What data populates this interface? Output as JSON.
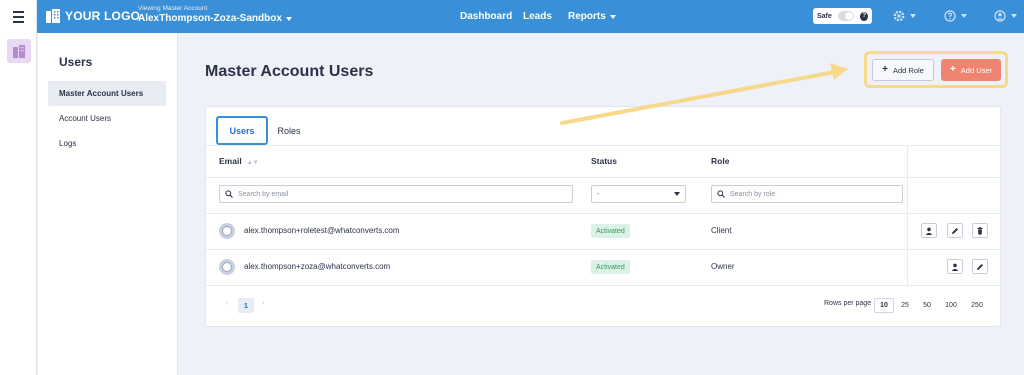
{
  "header": {
    "logo_text": "YOUR LOGO",
    "account_sub": "Viewing Master Account",
    "account_name": "AlexThompson-Zoza-Sandbox",
    "nav": [
      {
        "label": "Dashboard"
      },
      {
        "label": "Leads"
      },
      {
        "label": "Reports"
      }
    ],
    "safe_label": "Safe",
    "safe_help": "?",
    "colors": {
      "bar": "#3a8fd9",
      "accent": "#ef8470"
    }
  },
  "sidebar": {
    "title": "Users",
    "items": [
      {
        "label": "Master Account Users",
        "active": true
      },
      {
        "label": "Account Users",
        "active": false
      },
      {
        "label": "Logs",
        "active": false
      }
    ]
  },
  "main": {
    "title": "Master Account Users",
    "add_role_label": "Add Role",
    "add_user_label": "Add User",
    "tabs": [
      {
        "label": "Users",
        "active": true
      },
      {
        "label": "Roles",
        "active": false
      }
    ],
    "columns": {
      "email": "Email",
      "status": "Status",
      "role": "Role"
    },
    "filters": {
      "email_placeholder": "Search by email",
      "status_value": "-",
      "role_placeholder": "Search by role"
    },
    "rows": [
      {
        "email": "alex.thompson+roletest@whatconverts.com",
        "status": "Activated",
        "role": "Client"
      },
      {
        "email": "alex.thompson+zoza@whatconverts.com",
        "status": "Activated",
        "role": "Owner"
      }
    ],
    "pagination": {
      "prev": "‹",
      "current": "1",
      "next": "›",
      "rows_per_page_label": "Rows per page",
      "options": [
        "10",
        "25",
        "50",
        "100",
        "250"
      ],
      "selected": "10"
    }
  }
}
